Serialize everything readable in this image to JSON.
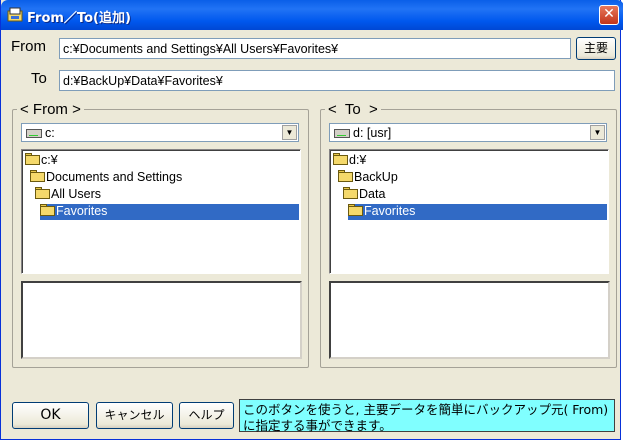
{
  "window": {
    "title": "From／To(追加)",
    "close_glyph": "✕"
  },
  "from_field": {
    "label": "From",
    "value": "c:¥Documents and Settings¥All Users¥Favorites¥"
  },
  "to_field": {
    "label": "To",
    "value": "d:¥BackUp¥Data¥Favorites¥"
  },
  "main_button": {
    "label": "主要"
  },
  "left_panel": {
    "title": "< From >",
    "drive": "c:",
    "tree": [
      {
        "label": "c:¥",
        "selected": false
      },
      {
        "label": "Documents and Settings",
        "selected": false
      },
      {
        "label": "All Users",
        "selected": false
      },
      {
        "label": "Favorites",
        "selected": true
      }
    ]
  },
  "right_panel": {
    "title": "<  To  >",
    "drive": "d: [usr]",
    "tree": [
      {
        "label": "d:¥",
        "selected": false
      },
      {
        "label": "BackUp",
        "selected": false
      },
      {
        "label": "Data",
        "selected": false
      },
      {
        "label": "Favorites",
        "selected": true
      }
    ]
  },
  "buttons": {
    "ok": "OK",
    "cancel": "キャンセル",
    "help": "ヘルプ"
  },
  "help_text": "このボタンを使うと, 主要データを簡単にバックアップ元( From)に指定する事ができます。",
  "colors": {
    "selection": "#316ac5",
    "help_bg": "#80ffff",
    "titlebar": "#0058ee"
  },
  "icons": {
    "app": "folder-app-icon",
    "drive": "drive-icon",
    "folder": "folder-icon",
    "dropdown": "chevron-down-icon"
  }
}
